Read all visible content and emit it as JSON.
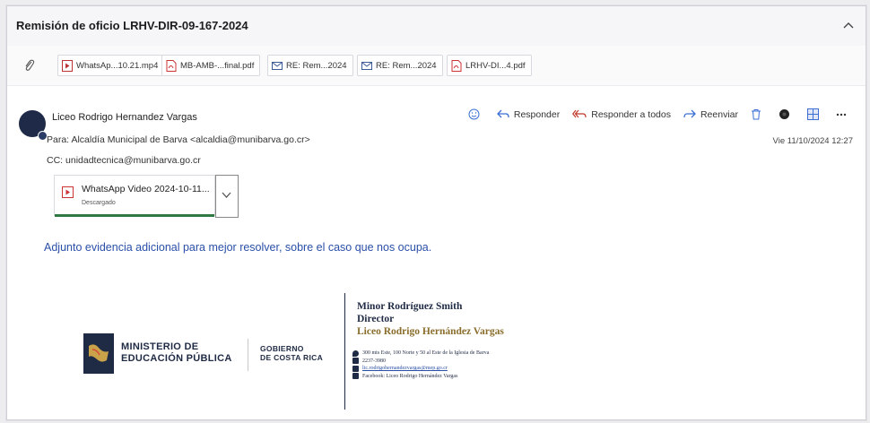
{
  "email": {
    "subject": "Remisión de oficio LRHV-DIR-09-167-2024",
    "attachments": [
      {
        "label": "WhatsAp...10.21.mp4",
        "icon": "video-file-icon"
      },
      {
        "label": "MB-AMB-...final.pdf",
        "icon": "pdf-file-icon"
      },
      {
        "label": "RE: Rem...2024",
        "icon": "email-message-icon"
      },
      {
        "label": "RE: Rem...2024",
        "icon": "email-message-icon"
      },
      {
        "label": "LRHV-DI...4.pdf",
        "icon": "pdf-file-icon"
      }
    ],
    "sender": "Liceo Rodrigo Hernandez Vargas",
    "to_label": "Para:",
    "to": "Alcaldía Municipal de Barva <alcaldia@munibarva.go.cr>",
    "cc_label": "CC:",
    "cc": "unidadtecnica@munibarva.go.cr",
    "actions": {
      "reply": "Responder",
      "reply_all": "Responder a todos",
      "forward": "Reenviar"
    },
    "date": "Vie 11/10/2024 12:27",
    "download": {
      "name": "WhatsApp Video 2024-10-11...",
      "status": "Descargado",
      "progress": 1.0
    },
    "body": "Adjunto evidencia adicional para mejor resolver, sobre el caso que nos ocupa."
  },
  "signature": {
    "ministry_line1": "MINISTERIO DE",
    "ministry_line2": "EDUCACIÓN PÚBLICA",
    "gov_line1": "GOBIERNO",
    "gov_line2": "DE COSTA RICA",
    "name": "Minor Rodríguez Smith",
    "title": "Director",
    "school": "Liceo Rodrigo Hernández Vargas",
    "address": "300 mts Este, 100 Norte y 50 al Este de la Iglesia de Barva",
    "phone": "2237-3980",
    "email": "lic.rodrigohernandezvargas@mep.go.cr",
    "facebook": "Facebook: Liceo Rodrigo Hernández Vargas"
  },
  "colors": {
    "accent_blue": "#2a4fa8",
    "download_bar": "#2f7a43",
    "brand_navy": "#1f2a44"
  }
}
